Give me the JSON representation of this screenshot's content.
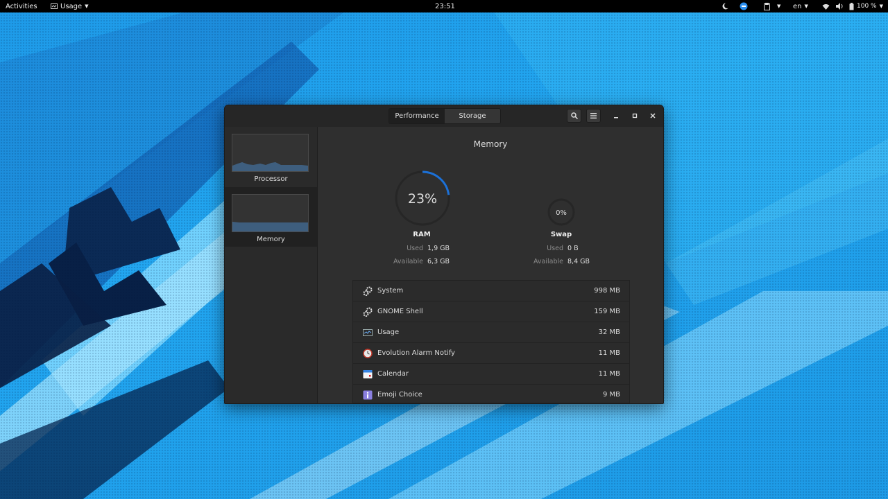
{
  "topbar": {
    "activities": "Activities",
    "app_menu": "Usage",
    "clock": "23:51",
    "language": "en",
    "battery": "100 %"
  },
  "window": {
    "tabs": [
      {
        "label": "Performance",
        "active": true
      },
      {
        "label": "Storage",
        "active": false
      }
    ],
    "sidebar": [
      {
        "label": "Processor",
        "selected": false
      },
      {
        "label": "Memory",
        "selected": true
      }
    ],
    "memory": {
      "title": "Memory",
      "ram": {
        "label": "RAM",
        "percent_text": "23%",
        "fraction": 0.23,
        "used_label": "Used",
        "used": "1,9 GB",
        "available_label": "Available",
        "available": "6,3 GB"
      },
      "swap": {
        "label": "Swap",
        "percent_text": "0%",
        "fraction": 0.0,
        "used_label": "Used",
        "used": "0 B",
        "available_label": "Available",
        "available": "8,4 GB"
      }
    },
    "processes": [
      {
        "name": "System",
        "value": "998 MB",
        "icon": "gear-icon"
      },
      {
        "name": "GNOME Shell",
        "value": "159 MB",
        "icon": "gear-icon"
      },
      {
        "name": "Usage",
        "value": "32 MB",
        "icon": "usage-app-icon"
      },
      {
        "name": "Evolution Alarm Notify",
        "value": "11 MB",
        "icon": "alarm-clock-icon"
      },
      {
        "name": "Calendar",
        "value": "11 MB",
        "icon": "calendar-icon"
      },
      {
        "name": "Emoji Choice",
        "value": "9 MB",
        "icon": "info-icon"
      }
    ]
  },
  "colors": {
    "accent": "#1c71d8",
    "window_bg": "#2d2d2d",
    "wallpaper": "#22a6f0"
  }
}
